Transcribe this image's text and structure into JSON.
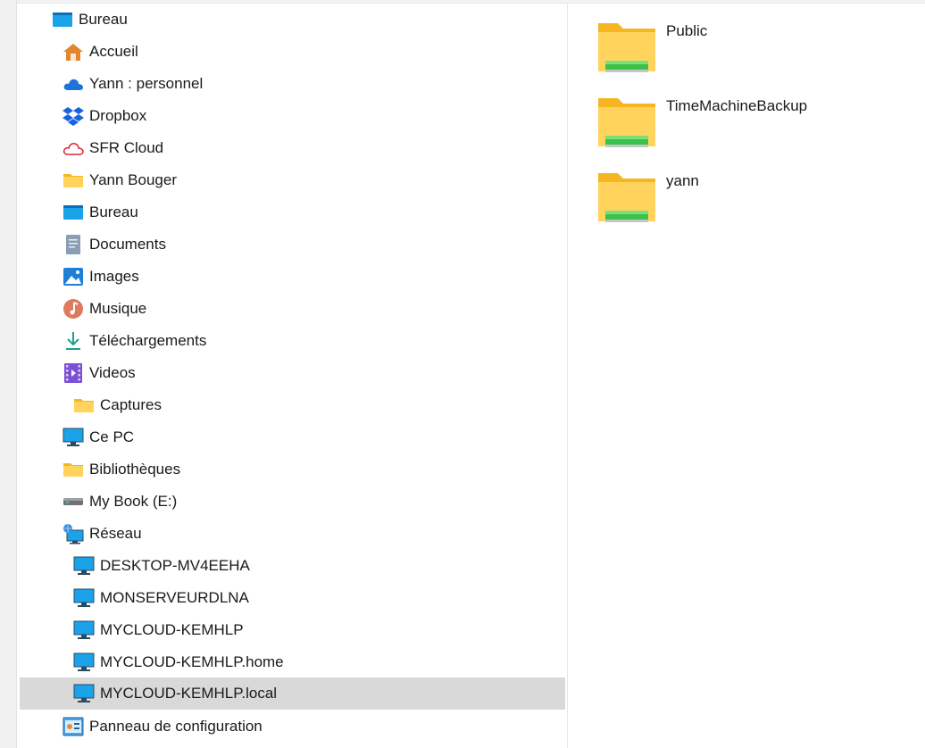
{
  "navigation": {
    "items": [
      {
        "label": "Bureau",
        "icon": "desktop-icon"
      },
      {
        "label": "Accueil",
        "icon": "home-icon"
      },
      {
        "label": "Yann : personnel",
        "icon": "onedrive-cloud-icon"
      },
      {
        "label": "Dropbox",
        "icon": "dropbox-icon"
      },
      {
        "label": "SFR Cloud",
        "icon": "sfr-cloud-icon"
      },
      {
        "label": "Yann Bouger",
        "icon": "folder-icon"
      },
      {
        "label": "Bureau",
        "icon": "desktop-icon"
      },
      {
        "label": "Documents",
        "icon": "documents-icon"
      },
      {
        "label": "Images",
        "icon": "pictures-icon"
      },
      {
        "label": "Musique",
        "icon": "music-icon"
      },
      {
        "label": "Téléchargements",
        "icon": "download-icon"
      },
      {
        "label": "Videos",
        "icon": "videos-icon"
      },
      {
        "label": "Captures",
        "icon": "folder-icon"
      },
      {
        "label": "Ce PC",
        "icon": "computer-icon"
      },
      {
        "label": "Bibliothèques",
        "icon": "libraries-folder-icon"
      },
      {
        "label": "My Book (E:)",
        "icon": "drive-icon"
      },
      {
        "label": "Réseau",
        "icon": "network-icon"
      },
      {
        "label": "DESKTOP-MV4EEHA",
        "icon": "computer-icon"
      },
      {
        "label": "MONSERVEURDLNA",
        "icon": "computer-icon"
      },
      {
        "label": "MYCLOUD-KEMHLP",
        "icon": "computer-icon"
      },
      {
        "label": "MYCLOUD-KEMHLP.home",
        "icon": "computer-icon"
      },
      {
        "label": "MYCLOUD-KEMHLP.local",
        "icon": "computer-icon",
        "selected": true
      },
      {
        "label": "Panneau de configuration",
        "icon": "control-panel-icon"
      }
    ]
  },
  "content": {
    "folders": [
      {
        "name": "Public",
        "icon": "shared-folder-icon"
      },
      {
        "name": "TimeMachineBackup",
        "icon": "shared-folder-icon"
      },
      {
        "name": "yann",
        "icon": "shared-folder-icon"
      }
    ]
  },
  "colors": {
    "selection": "#d9d9d9",
    "folder_yellow": "#ffd35c",
    "share_green": "#3cc24a",
    "accent_blue": "#1e88e5"
  }
}
